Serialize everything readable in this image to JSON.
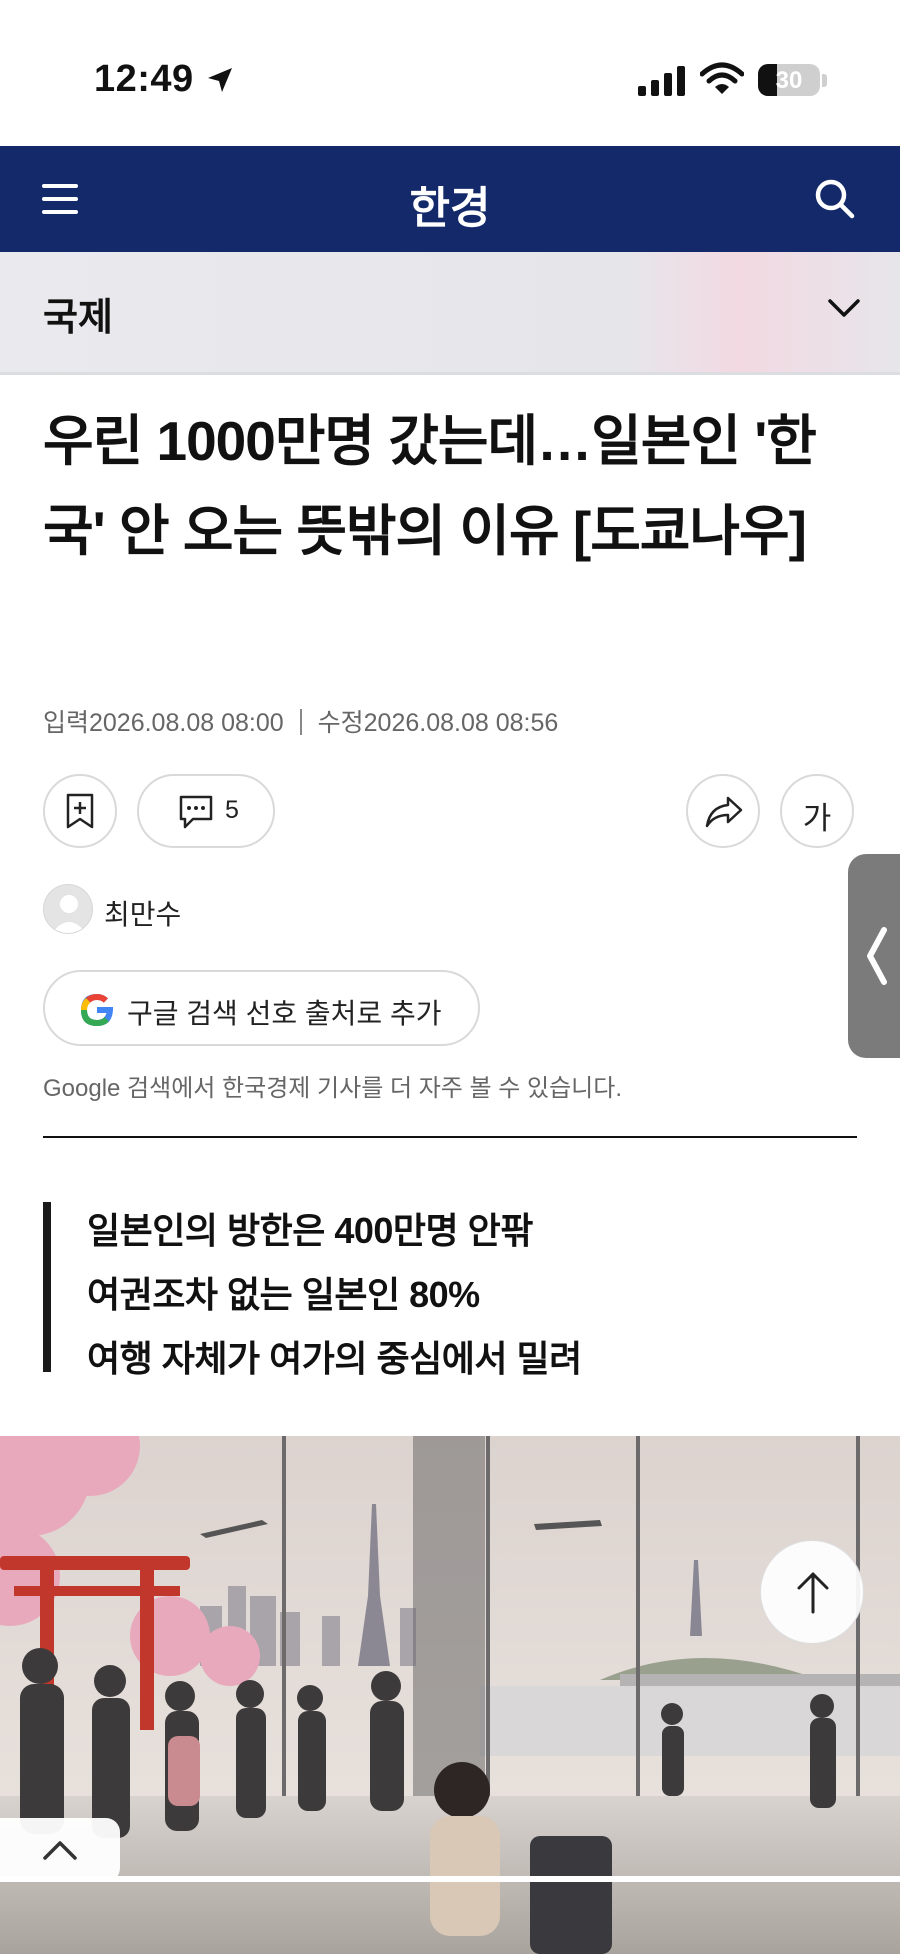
{
  "status_bar": {
    "time": "12:49",
    "battery": "30",
    "battery_level": 0.3
  },
  "header": {
    "logo": "한경",
    "menu_icon": "hamburger-icon",
    "search_icon": "search-icon"
  },
  "section": {
    "title": "국제",
    "dropdown_icon": "chevron-down-icon"
  },
  "article": {
    "headline": "우린 1000만명 갔는데…일본인 '한국' 안 오는 뜻밖의 이유 [도쿄나우]",
    "input_date": "입력2026.08.08 08:00",
    "modified_date": "수정2026.08.08 08:56",
    "comment_count": "5",
    "font_size_label": "가",
    "author": "최만수",
    "google_button_label": "구글 검색 선호 출처로 추가",
    "google_note": "Google 검색에서 한국경제 기사를 더 자주 볼 수 있습니다.",
    "summary": [
      "일본인의 방한은 400만명 안팎",
      "여권조차 없는 일본인 80%",
      "여행 자체가 여가의 중심에서 밀려"
    ]
  },
  "colors": {
    "nav_background": "#13296a",
    "section_background": "#e6e6ea",
    "text": "#111111"
  }
}
